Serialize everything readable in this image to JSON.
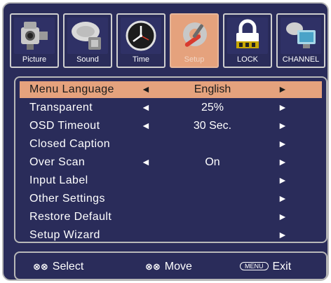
{
  "tabs": [
    {
      "label": "Picture",
      "icon": "camcorder-icon"
    },
    {
      "label": "Sound",
      "icon": "satellite-dish-icon"
    },
    {
      "label": "Time",
      "icon": "clock-icon"
    },
    {
      "label": "Setup",
      "icon": "tools-icon",
      "active": true
    },
    {
      "label": "LOCK",
      "icon": "lock-icon"
    },
    {
      "label": "CHANNEL",
      "icon": "tv-antenna-icon"
    }
  ],
  "menu": {
    "items": [
      {
        "label": "Menu Language",
        "value": "English",
        "left_arrow": "◄",
        "right_arrow": "►",
        "highlighted": true
      },
      {
        "label": "Transparent",
        "value": "25%",
        "left_arrow": "◄",
        "right_arrow": "►"
      },
      {
        "label": "OSD Timeout",
        "value": "30 Sec.",
        "left_arrow": "◄",
        "right_arrow": "►"
      },
      {
        "label": "Closed Caption",
        "value": "",
        "left_arrow": "",
        "right_arrow": "►"
      },
      {
        "label": "Over Scan",
        "value": "On",
        "left_arrow": "◄",
        "right_arrow": "►"
      },
      {
        "label": "Input Label",
        "value": "",
        "left_arrow": "",
        "right_arrow": "►"
      },
      {
        "label": "Other Settings",
        "value": "",
        "left_arrow": "",
        "right_arrow": "►"
      },
      {
        "label": "Restore Default",
        "value": "",
        "left_arrow": "",
        "right_arrow": "►"
      },
      {
        "label": "Setup Wizard",
        "value": "",
        "left_arrow": "",
        "right_arrow": "►"
      }
    ]
  },
  "footer": {
    "select_keys": "⊗⊗",
    "select_label": "Select",
    "move_keys": "⊗⊗",
    "move_label": "Move",
    "menu_key": "MENU",
    "exit_label": "Exit"
  },
  "colors": {
    "background": "#2a2c5a",
    "highlight": "#e5a27d",
    "border": "#b8b8b8"
  }
}
